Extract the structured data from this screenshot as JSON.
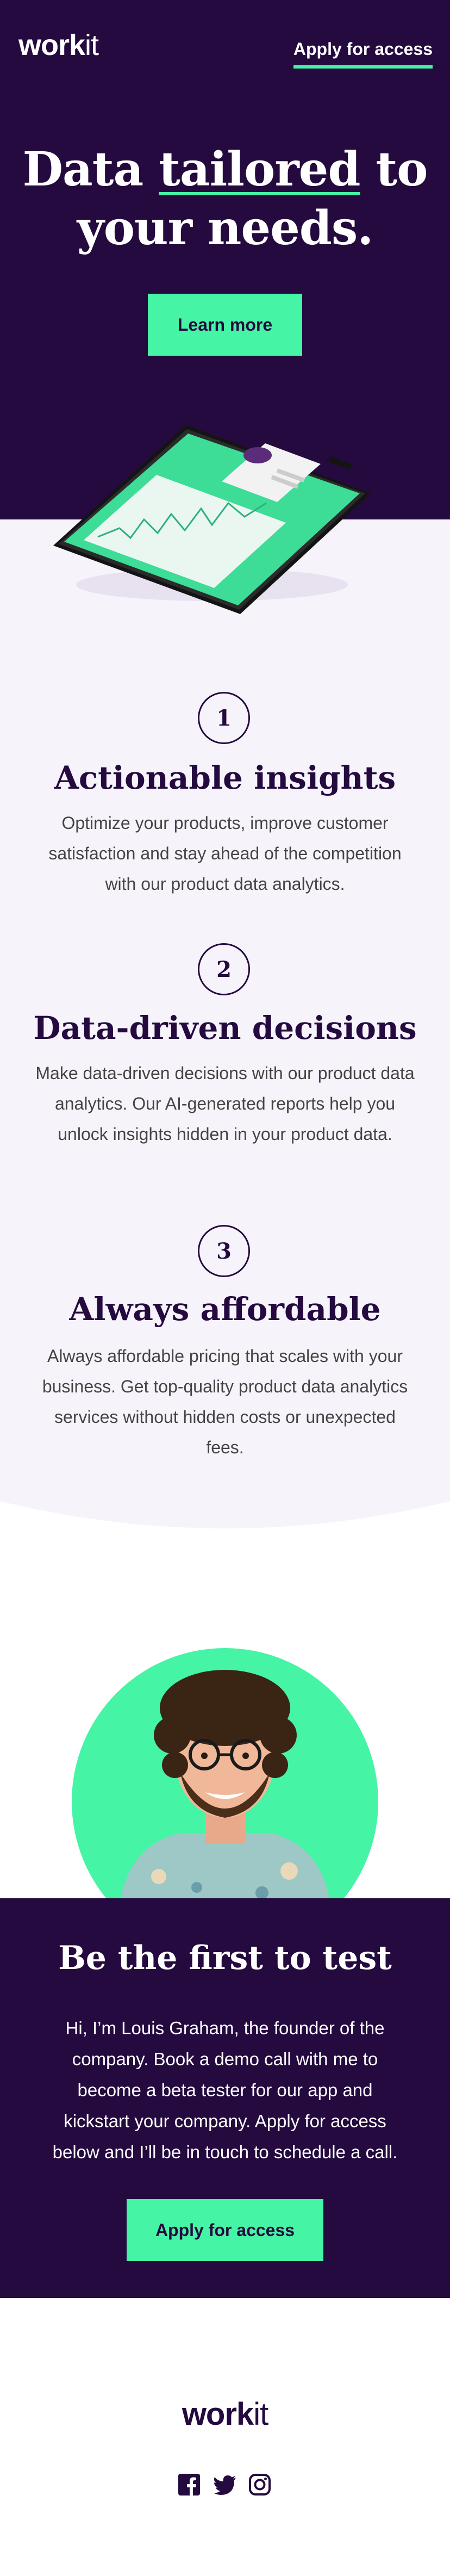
{
  "header": {
    "logo_bold": "work",
    "logo_light": "it",
    "apply_link": "Apply for access"
  },
  "hero": {
    "title_line1_before": "Data ",
    "title_line1_highlight": "tailored",
    "title_line1_after": " to",
    "title_line2": "your needs.",
    "cta": "Learn more"
  },
  "features": [
    {
      "number": "1",
      "title": "Actionable insights",
      "text": "Optimize your products, improve customer satisfaction and stay ahead of the competition with our product data analytics."
    },
    {
      "number": "2",
      "title": "Data-driven decisions",
      "text": "Make data-driven decisions with our product data analytics. Our AI-generated reports help you unlock insights hidden in your product data."
    },
    {
      "number": "3",
      "title": "Always affordable",
      "text": "Always affordable pricing that scales with your business. Get top-quality product data analytics services without hidden costs or unexpected fees."
    }
  ],
  "cta": {
    "title": "Be the first to test",
    "text": "Hi, I’m Louis Graham, the founder of the company. Book a demo call with me to become a beta tester for our app and kickstart your company. Apply for access below and I’ll be in touch to schedule a call.",
    "button": "Apply for access"
  },
  "footer": {
    "logo_bold": "work",
    "logo_light": "it",
    "social_icons": [
      "facebook-icon",
      "twitter-icon",
      "instagram-icon"
    ]
  },
  "colors": {
    "primary_dark": "#240a3f",
    "accent_green": "#45f4a5",
    "light_bg": "#f6f3fa"
  }
}
